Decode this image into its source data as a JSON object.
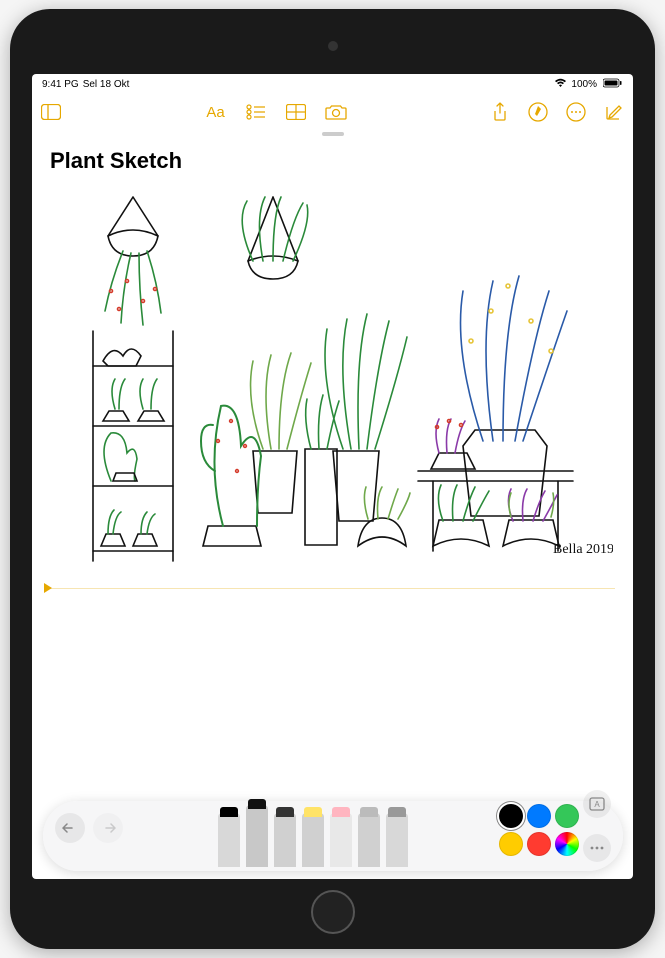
{
  "status_bar": {
    "time": "9:41 PG",
    "date": "Sel 18 Okt",
    "wifi": "wifi",
    "battery_pct": "100%"
  },
  "toolbar": {
    "sidebar": "Sidebar",
    "format": "Aa",
    "checklist": "Checklist",
    "table": "Table",
    "camera": "Camera",
    "share": "Share",
    "markup_toggle": "Markup",
    "more": "More",
    "compose": "Compose"
  },
  "note": {
    "title": "Plant Sketch",
    "signature": "Bella 2019"
  },
  "palette": {
    "undo": "Undo",
    "redo": "Redo",
    "tools": [
      {
        "name": "pen",
        "tip_color": "#000",
        "selected": false,
        "body": "#d8d8d8"
      },
      {
        "name": "marker",
        "tip_color": "#111",
        "selected": true,
        "body": "#c8c8c8"
      },
      {
        "name": "pencil",
        "tip_color": "#333",
        "selected": false,
        "body": "#d0d0d0"
      },
      {
        "name": "highlighter",
        "tip_color": "#ffe367",
        "selected": false,
        "body": "#d0d0d0"
      },
      {
        "name": "eraser",
        "tip_color": "#ffb5c0",
        "selected": false,
        "body": "#e8e8e8"
      },
      {
        "name": "lasso",
        "tip_color": "#bbb",
        "selected": false,
        "body": "#d0d0d0"
      },
      {
        "name": "ruler",
        "tip_color": "#999",
        "selected": false,
        "body": "#d8d8d8"
      }
    ],
    "colors": [
      {
        "name": "black",
        "hex": "#000000",
        "selected": true
      },
      {
        "name": "blue",
        "hex": "#007aff",
        "selected": false
      },
      {
        "name": "green",
        "hex": "#34c759",
        "selected": false
      },
      {
        "name": "yellow",
        "hex": "#ffcc00",
        "selected": false
      },
      {
        "name": "red",
        "hex": "#ff3b30",
        "selected": false
      },
      {
        "name": "picker",
        "hex": "wheel",
        "selected": false
      }
    ],
    "textbox": "Text box",
    "more": "More"
  },
  "accent": "#e6a800"
}
